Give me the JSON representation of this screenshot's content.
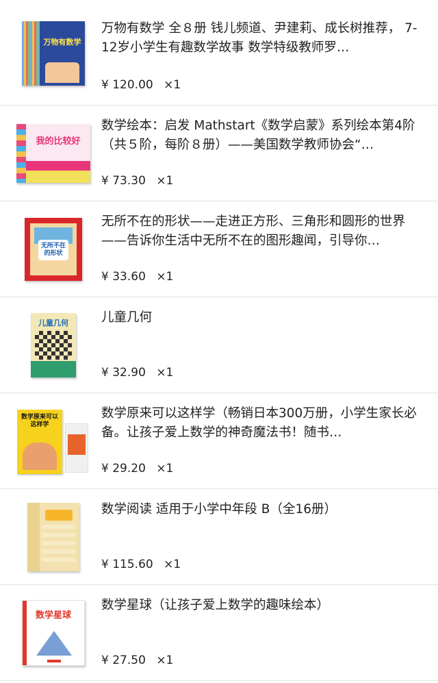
{
  "currency_symbol": "¥",
  "items": [
    {
      "title": "万物有数学 全８册 钱儿频道、尹建莉、成长树推荐， 7-12岁小学生有趣数学故事 数学特级教师罗…",
      "price": "120.00",
      "qty": "×1",
      "cover_text": "万物有数学",
      "cover_color": "#2c4a9c"
    },
    {
      "title": "数学绘本：启发 Mathstart《数学启蒙》系列绘本第4阶（共５阶，每阶８册）——美国数学教师协会“…",
      "price": "73.30",
      "qty": "×1",
      "cover_text": "我的比较好",
      "cover_color": "#f3e05a"
    },
    {
      "title": "无所不在的形状——走进正方形、三角形和圆形的世界——告诉你生活中无所不在的图形趣闻，引导你…",
      "price": "33.60",
      "qty": "×1",
      "cover_text": "无所不在的形状",
      "cover_color": "#d9262a"
    },
    {
      "title": "儿童几何",
      "price": "32.90",
      "qty": "×1",
      "cover_text": "儿童几何",
      "cover_color": "#2f9d6e"
    },
    {
      "title": "数学原来可以这样学（畅销日本300万册，小学生家长必备。让孩子爱上数学的神奇魔法书！随书…",
      "price": "29.20",
      "qty": "×1",
      "cover_text": "数学原来可以这样学",
      "cover_color": "#f7d21c"
    },
    {
      "title": "数学阅读 适用于小学中年段 B（全16册）",
      "price": "115.60",
      "qty": "×1",
      "cover_text": "",
      "cover_color": "#f3e2b0"
    },
    {
      "title": "数学星球（让孩子爱上数学的趣味绘本）",
      "price": "27.50",
      "qty": "×1",
      "cover_text": "数学星球",
      "cover_color": "#ffffff"
    }
  ]
}
